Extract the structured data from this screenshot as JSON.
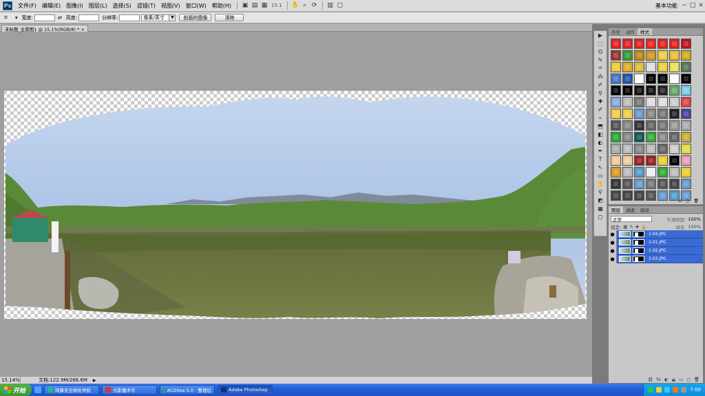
{
  "app": {
    "logo_text": "Ps",
    "zoom_select": "15.1",
    "workspace": "基本功能",
    "window_controls": {
      "minimize": "−",
      "restore": "□",
      "close": "×"
    }
  },
  "menu": [
    {
      "id": "file",
      "label": "文件(F)"
    },
    {
      "id": "edit",
      "label": "编辑(E)"
    },
    {
      "id": "image",
      "label": "图像(I)"
    },
    {
      "id": "layer",
      "label": "图层(L)"
    },
    {
      "id": "select",
      "label": "选择(S)"
    },
    {
      "id": "filter",
      "label": "滤镜(T)"
    },
    {
      "id": "view",
      "label": "视图(V)"
    },
    {
      "id": "window",
      "label": "窗口(W)"
    },
    {
      "id": "help",
      "label": "帮助(H)"
    }
  ],
  "options_bar": {
    "width_label": "宽度:",
    "height_label": "高度:",
    "resolution_label": "分辨率:",
    "unit_select": "像素/英寸",
    "front_image_button": "前面的图像",
    "clear_button": "清除"
  },
  "document_tab": {
    "title": "未标题_全景图1 @ 15.1%(RGB/8) * ×"
  },
  "status_bar": {
    "zoom": "15.14%",
    "doc_info": "文档:122.9M/266.6M"
  },
  "tools_panel": {
    "icons": [
      "▶",
      "⬚",
      "ʘ",
      "✎",
      "⌗",
      "⁂",
      "✐",
      "⚲",
      "✚",
      "✐",
      "⌁",
      "⬒",
      "◧",
      "◐",
      "✒",
      "T",
      "↖",
      "▭",
      "✋",
      "⚲",
      "◩",
      "▦",
      "◻"
    ]
  },
  "styles_panel": {
    "tabs": [
      {
        "id": "history",
        "label": "历史"
      },
      {
        "id": "actions",
        "label": "动作"
      },
      {
        "id": "styles",
        "label": "样式"
      }
    ],
    "active_tab": "styles",
    "swatches": [
      "#d22",
      "#d22",
      "#d22",
      "#e22",
      "#d22",
      "#d22",
      "#b12",
      "#933",
      "#393",
      "#b81",
      "#c92",
      "#ec4",
      "#eb3",
      "#ca2",
      "#ec3",
      "#da2",
      "#db3",
      "#ddd",
      "#ec4",
      "#ed5",
      "#575",
      "#47c",
      "#25a",
      "#fff",
      "#000",
      "#000",
      "#fff",
      "#000",
      "#000",
      "#000",
      "#111",
      "#111",
      "#222",
      "#6a6",
      "#7ce",
      "#8ad",
      "#bbb",
      "#777",
      "#ddd",
      "#ddd",
      "#ccc",
      "#d44",
      "#ec4",
      "#ec4",
      "#69c",
      "#888",
      "#777",
      "#222",
      "#449",
      "#555",
      "#888",
      "#333",
      "#666",
      "#777",
      "#999",
      "#aaa",
      "#2a3",
      "#888",
      "#155",
      "#3a3",
      "#888",
      "#666",
      "#ca3",
      "#aaa",
      "#bbb",
      "#888",
      "#bbb",
      "#666",
      "#ccc",
      "#dd4",
      "#ec9",
      "#ec9",
      "#922",
      "#922",
      "#ec3",
      "#000",
      "#e9b",
      "#d92",
      "#bbb",
      "#59c",
      "#eee",
      "#3a3",
      "#bbb",
      "#ec3",
      "#333",
      "#555",
      "#69c",
      "#777",
      "#555",
      "#444",
      "#69c",
      "#444",
      "#444",
      "#444",
      "#555",
      "#69c",
      "#59c",
      "#69c"
    ],
    "footer_icons": [
      "⊘",
      "◻",
      "🗑"
    ]
  },
  "layers_panel": {
    "tabs": [
      {
        "id": "layers",
        "label": "图层"
      },
      {
        "id": "channels",
        "label": "通道"
      },
      {
        "id": "paths",
        "label": "路径"
      }
    ],
    "active_tab": "layers",
    "blend_mode": "正常",
    "opacity_label": "不透明度:",
    "opacity_value": "100%",
    "lock_label": "锁定:",
    "fill_label": "填充:",
    "fill_value": "100%",
    "layers": [
      {
        "name": "1-04.JPG"
      },
      {
        "name": "1-01.JPG"
      },
      {
        "name": "1-02.JPG"
      },
      {
        "name": "1-03.JPG"
      }
    ],
    "footer_icons": [
      "⛓",
      "fx",
      "◐",
      "◒",
      "▭",
      "◻",
      "🗑"
    ]
  },
  "taskbar": {
    "start_label": "开始",
    "tasks": [
      {
        "label": "网康安全网址导航",
        "color": "#2b8"
      },
      {
        "label": "光影魔术手",
        "color": "#d33"
      },
      {
        "label": "ACDSee 5.0 - 整理后",
        "color": "#2a6"
      },
      {
        "label": "Adobe Photoshop",
        "color": "#136"
      }
    ],
    "active_task": 3,
    "clock": "7:00",
    "tray_colors": [
      "#2c4",
      "#fc3",
      "#3cf",
      "#f70",
      "#999"
    ]
  }
}
